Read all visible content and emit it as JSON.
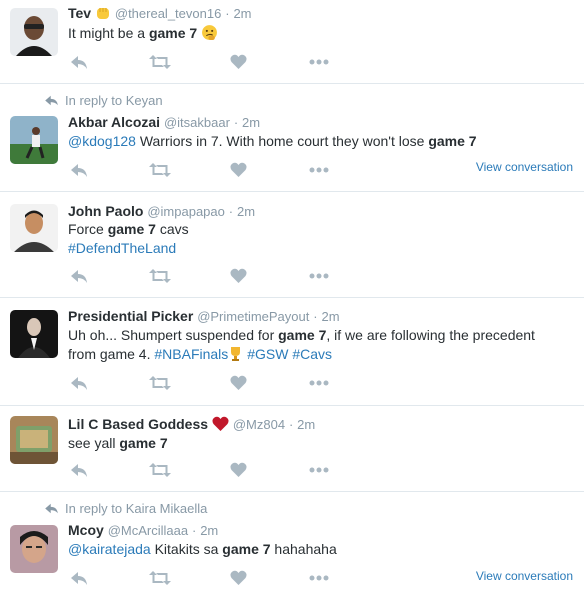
{
  "reply_prefix": "In reply to",
  "view_conversation_label": "View conversation",
  "tweets": [
    {
      "name": "Tev",
      "handle": "@thereal_tevon16",
      "sep": "·",
      "time": "2m",
      "text_pre": "It might be a ",
      "text_bold": "game 7",
      "text_post": " "
    },
    {
      "reply_to": "Keyan",
      "name": "Akbar Alcozai",
      "handle": "@itsakbaar",
      "sep": "·",
      "time": "2m",
      "mention": "@kdog128",
      "text_pre": " Warriors in 7. With home court they won't lose ",
      "text_bold": "game 7"
    },
    {
      "name": "John Paolo",
      "handle": "@impapapao",
      "sep": "·",
      "time": "2m",
      "text_pre": "Force ",
      "text_bold": "game 7",
      "text_post": " cavs",
      "hashtag": "#DefendTheLand"
    },
    {
      "name": "Presidential Picker",
      "handle": "@PrimetimePayout",
      "sep": "·",
      "time": "2m",
      "text_pre": "Uh oh... Shumpert suspended for ",
      "text_bold": "game 7",
      "text_post": ", if we are following the precedent",
      "line2_pre": "from game 4. ",
      "tag1": "#NBAFinals",
      "tag2": "#GSW",
      "tag3": "#Cavs"
    },
    {
      "name": "Lil C Based Goddess",
      "handle": "@Mz804",
      "sep": "·",
      "time": "2m",
      "text_pre": "see yall ",
      "text_bold": "game 7"
    },
    {
      "reply_to": "Kaira Mikaella",
      "name": "Mcoy",
      "handle": "@McArcillaaa",
      "sep": "·",
      "time": "2m",
      "mention": "@kairatejada",
      "text_pre": " Kitakits sa ",
      "text_bold": "game 7",
      "text_post": " hahahaha"
    }
  ],
  "colors": {
    "link": "#2b7bb9",
    "muted": "#8899a6",
    "icon": "#aab8c2",
    "divider": "#e1e8ed"
  }
}
